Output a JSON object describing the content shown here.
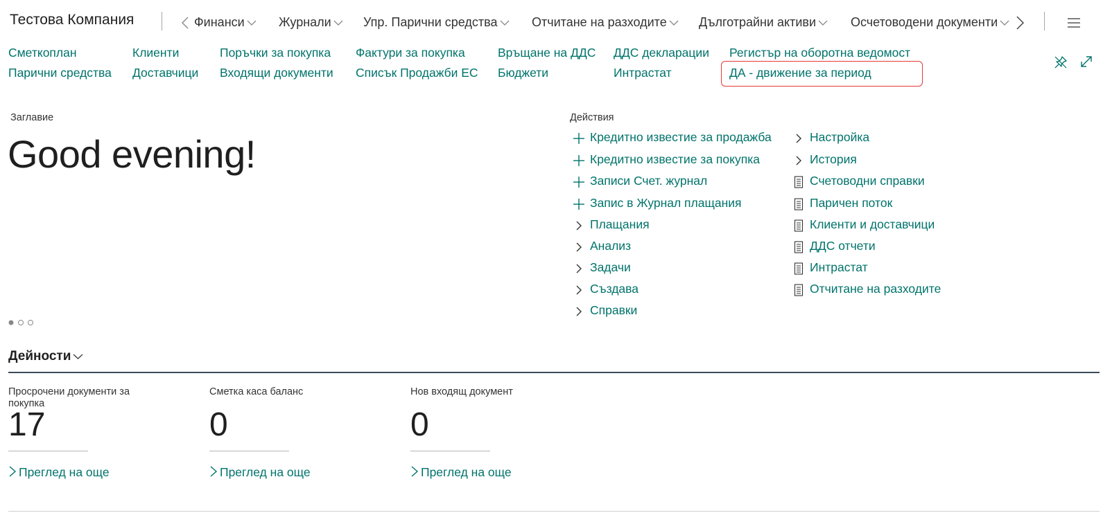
{
  "app": {
    "company": "Тестова Компания"
  },
  "nav": {
    "tabs": [
      {
        "label": "Финанси"
      },
      {
        "label": "Журнали"
      },
      {
        "label": "Упр. Парични средства"
      },
      {
        "label": "Отчитане на разходите"
      },
      {
        "label": "Дълготрайни активи"
      },
      {
        "label": "Осчетоводени документи"
      }
    ]
  },
  "links": {
    "row1": [
      "Сметкоплан",
      "Клиенти",
      "Поръчки за покупка",
      "Фактури за покупка",
      "Връщане на ДДС",
      "ДДС декларации",
      "Регистър на оборотна ведомост"
    ],
    "row2": [
      "Парични средства",
      "Доставчици",
      "Входящи документи",
      "Списък Продажби ЕС",
      "Бюджети",
      "Интрастат",
      "ДА - движение за период"
    ]
  },
  "headline": {
    "caption": "Заглавие",
    "greeting": "Good evening!"
  },
  "actions": {
    "title": "Действия",
    "col1": [
      {
        "icon": "plus-icon",
        "label": "Кредитно известие за продажба"
      },
      {
        "icon": "plus-icon",
        "label": "Кредитно известие за покупка"
      },
      {
        "icon": "plus-icon",
        "label": "Записи Счет. журнал"
      },
      {
        "icon": "plus-icon",
        "label": "Запис в Журнал плащания"
      },
      {
        "icon": "chevron-right-icon",
        "label": "Плащания"
      },
      {
        "icon": "chevron-right-icon",
        "label": "Анализ"
      },
      {
        "icon": "chevron-right-icon",
        "label": "Задачи"
      },
      {
        "icon": "chevron-right-icon",
        "label": "Създава"
      },
      {
        "icon": "chevron-right-icon",
        "label": "Справки"
      }
    ],
    "col2": [
      {
        "icon": "chevron-right-icon",
        "label": "Настройка"
      },
      {
        "icon": "chevron-right-icon",
        "label": "История"
      },
      {
        "icon": "report-icon",
        "label": "Счетоводни справки"
      },
      {
        "icon": "report-icon",
        "label": "Паричен поток"
      },
      {
        "icon": "report-icon",
        "label": "Клиенти и доставчици"
      },
      {
        "icon": "report-icon",
        "label": "ДДС отчети"
      },
      {
        "icon": "report-icon",
        "label": "Интрастат"
      },
      {
        "icon": "report-icon",
        "label": "Отчитане на разходите"
      }
    ]
  },
  "activities": {
    "title": "Дейности",
    "tiles": [
      {
        "label": "Просрочени документи за покупка",
        "value": "17",
        "more": "Преглед на още"
      },
      {
        "label": "Сметка каса баланс",
        "value": "0",
        "more": "Преглед на още"
      },
      {
        "label": "Нов входящ документ",
        "value": "0",
        "more": "Преглед на още"
      }
    ]
  },
  "colors": {
    "accent": "#00736b",
    "highlight": "#e53935",
    "text": "#212121"
  }
}
